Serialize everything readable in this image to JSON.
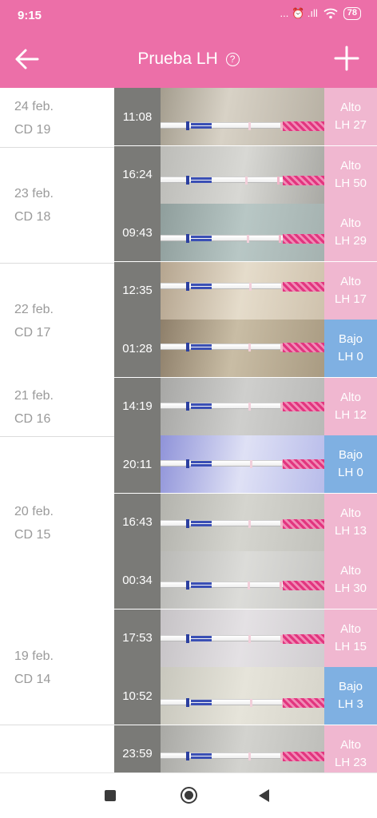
{
  "status": {
    "time": "9:15",
    "icons": "... ⏰ .ıll",
    "battery": "78"
  },
  "appbar": {
    "title": "Prueba LH",
    "help": "?",
    "back_icon": "arrow-left-icon",
    "add_icon": "plus-icon",
    "color": "#ec6fa8"
  },
  "days": [
    {
      "date": "24 feb.",
      "cd": "CD 19"
    },
    {
      "date": "23 feb.",
      "cd": "CD 18"
    },
    {
      "date": "22 feb.",
      "cd": "CD 17"
    },
    {
      "date": "21 feb.",
      "cd": "CD 16"
    },
    {
      "date": "20 feb.",
      "cd": "CD 15"
    },
    {
      "date": "19 feb.",
      "cd": "CD 14"
    }
  ],
  "tests": [
    {
      "time": "11:08",
      "level": "Alto",
      "value": "LH 27"
    },
    {
      "time": "16:24",
      "level": "Alto",
      "value": "LH 50"
    },
    {
      "time": "09:43",
      "level": "Alto",
      "value": "LH 29"
    },
    {
      "time": "12:35",
      "level": "Alto",
      "value": "LH 17"
    },
    {
      "time": "01:28",
      "level": "Bajo",
      "value": "LH 0"
    },
    {
      "time": "14:19",
      "level": "Alto",
      "value": "LH 12"
    },
    {
      "time": "20:11",
      "level": "Bajo",
      "value": "LH 0"
    },
    {
      "time": "16:43",
      "level": "Alto",
      "value": "LH 13"
    },
    {
      "time": "00:34",
      "level": "Alto",
      "value": "LH 30"
    },
    {
      "time": "17:53",
      "level": "Alto",
      "value": "LH 15"
    },
    {
      "time": "10:52",
      "level": "Bajo",
      "value": "LH 3"
    },
    {
      "time": "23:59",
      "level": "Alto",
      "value": "LH 23"
    }
  ],
  "colors": {
    "alto": "#f0b7d0",
    "bajo": "#7fb0e2",
    "accent": "#ec6fa8"
  },
  "navbar": {
    "recents_icon": "square-icon",
    "home_icon": "circle-icon",
    "back_icon": "triangle-back-icon"
  }
}
